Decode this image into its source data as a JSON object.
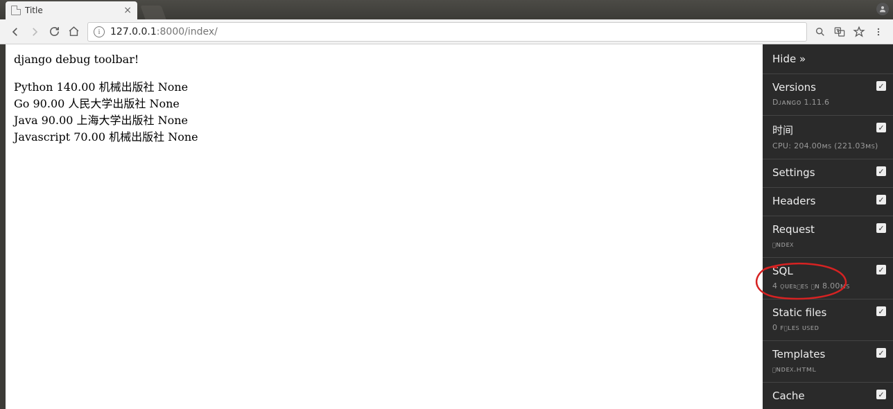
{
  "tab": {
    "title": "Title"
  },
  "address": {
    "host": "127.0.0.1",
    "port_path": ":8000/index/"
  },
  "page": {
    "heading": "django debug toolbar!",
    "rows": [
      "Python 140.00 机械出版社 None",
      "Go 90.00 人民大学出版社 None",
      "Java 90.00 上海大学出版社 None",
      "Javascript 70.00 机械出版社 None"
    ]
  },
  "djdt": {
    "hide": "Hide »",
    "panels": [
      {
        "title": "Versions",
        "sub": "Dᴊᴀɴɢᴏ 1.11.6",
        "checked": true
      },
      {
        "title": "时间",
        "sub": "CPU: 204.00ᴍs (221.03ᴍs)",
        "checked": true
      },
      {
        "title": "Settings",
        "sub": "",
        "checked": true
      },
      {
        "title": "Headers",
        "sub": "",
        "checked": true
      },
      {
        "title": "Request",
        "sub": "ɪɴᴅᴇx",
        "checked": true
      },
      {
        "title": "SQL",
        "sub": "4 ǫᴜᴇʀɪᴇs ɪɴ 8.00ᴍs",
        "checked": true
      },
      {
        "title": "Static files",
        "sub": "0 ꜰɪʟᴇs ᴜsᴇᴅ",
        "checked": true
      },
      {
        "title": "Templates",
        "sub": "ɪɴᴅᴇx.ʜᴛᴍʟ",
        "checked": true
      },
      {
        "title": "Cache",
        "sub": "",
        "checked": true
      }
    ]
  }
}
